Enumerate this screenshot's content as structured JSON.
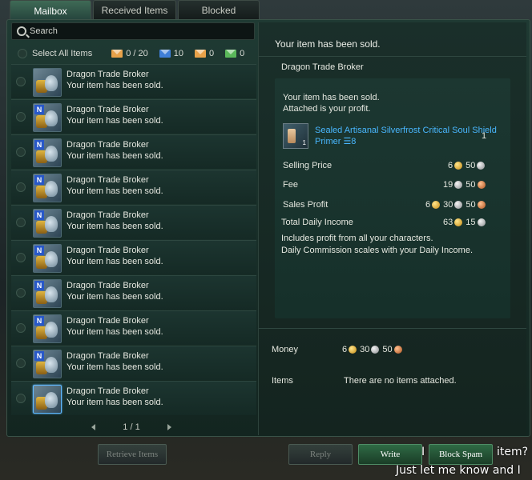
{
  "tabs": [
    {
      "label": "Mailbox",
      "active": true
    },
    {
      "label": "Received Items",
      "active": false
    },
    {
      "label": "Blocked",
      "active": false
    }
  ],
  "search": {
    "placeholder": "Search"
  },
  "select_all": {
    "label": "Select All Items",
    "counts": [
      {
        "icon": "orange-envelope-icon",
        "color": "#e8a24a",
        "value": "0 / 20"
      },
      {
        "icon": "blue-envelope-icon",
        "color": "#3f7fd8",
        "value": "10"
      },
      {
        "icon": "orange-package-envelope-icon",
        "color": "#e8a24a",
        "value": "0"
      },
      {
        "icon": "green-envelope-icon",
        "color": "#5ab85a",
        "value": "0"
      }
    ]
  },
  "mail_list": [
    {
      "sender": "Dragon Trade Broker",
      "subject": "Your item has been sold.",
      "new": false,
      "selected": false
    },
    {
      "sender": "Dragon Trade Broker",
      "subject": "Your item has been sold.",
      "new": true,
      "selected": false
    },
    {
      "sender": "Dragon Trade Broker",
      "subject": "Your item has been sold.",
      "new": true,
      "selected": false
    },
    {
      "sender": "Dragon Trade Broker",
      "subject": "Your item has been sold.",
      "new": true,
      "selected": false
    },
    {
      "sender": "Dragon Trade Broker",
      "subject": "Your item has been sold.",
      "new": true,
      "selected": false
    },
    {
      "sender": "Dragon Trade Broker",
      "subject": "Your item has been sold.",
      "new": true,
      "selected": false
    },
    {
      "sender": "Dragon Trade Broker",
      "subject": "Your item has been sold.",
      "new": true,
      "selected": false
    },
    {
      "sender": "Dragon Trade Broker",
      "subject": "Your item has been sold.",
      "new": true,
      "selected": false
    },
    {
      "sender": "Dragon Trade Broker",
      "subject": "Your item has been sold.",
      "new": true,
      "selected": false
    },
    {
      "sender": "Dragon Trade Broker",
      "subject": "Your item has been sold.",
      "new": false,
      "selected": true
    }
  ],
  "pager": {
    "text": "1 / 1"
  },
  "detail": {
    "title": "Your item has been sold.",
    "sender": "Dragon Trade Broker",
    "line1": "Your item has been sold.",
    "line2": "Attached is your profit.",
    "item_name": "Sealed Artisanal Silverfrost Critical Soul Shield Primer ☰8",
    "item_level_badge": "1",
    "item_qty": "1",
    "selling_price": {
      "label": "Selling Price",
      "gold": "6",
      "silver": "50"
    },
    "fee": {
      "label": "Fee",
      "silver": "19",
      "copper": "50"
    },
    "sales_profit": {
      "label": "Sales Profit",
      "gold": "6",
      "silver": "30",
      "copper": "50"
    },
    "total_daily": {
      "label": "Total Daily Income",
      "gold": "63",
      "silver": "15"
    },
    "note1": "Includes profit from all your characters.",
    "note2": "Daily Commission scales with your Daily Income."
  },
  "attachments": {
    "money_label": "Money",
    "money": {
      "gold": "6",
      "silver": "30",
      "copper": "50"
    },
    "items_label": "Items",
    "items_text": "There are no items attached."
  },
  "buttons": {
    "retrieve": "Retrieve Items",
    "reply": "Reply",
    "write": "Write",
    "block_spam": "Block Spam"
  },
  "overlay": {
    "line1_a": "I",
    "line1_b": "item?",
    "line2": "Just let me know and I"
  }
}
